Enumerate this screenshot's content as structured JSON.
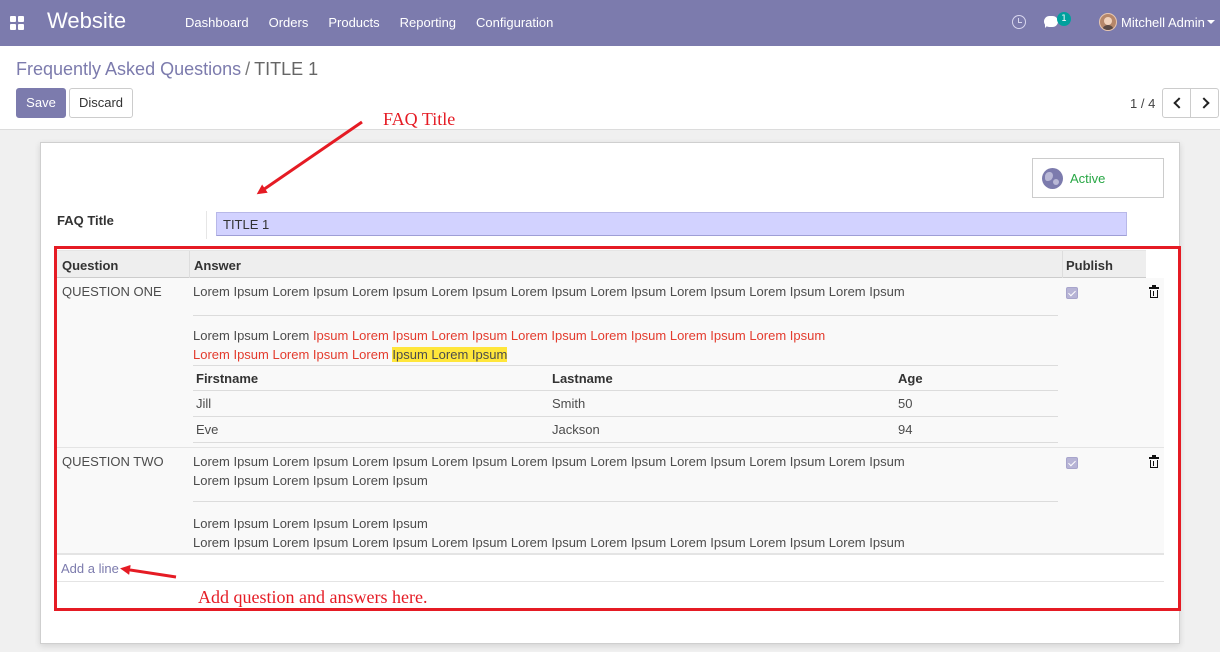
{
  "navbar": {
    "app_name": "Website",
    "menu": [
      "Dashboard",
      "Orders",
      "Products",
      "Reporting",
      "Configuration"
    ],
    "chat_badge": "1",
    "user_name": "Mitchell Admin"
  },
  "control_panel": {
    "breadcrumb_parent": "Frequently Asked Questions",
    "breadcrumb_separator": "/",
    "breadcrumb_current": "TITLE 1",
    "save_label": "Save",
    "discard_label": "Discard",
    "pager": "1 / 4"
  },
  "form": {
    "active_label": "Active",
    "faq_title_label": "FAQ Title",
    "faq_title_value": "TITLE 1"
  },
  "list": {
    "headers": {
      "question": "Question",
      "answer": "Answer",
      "publish": "Publish"
    },
    "rows": [
      {
        "question": "QUESTION ONE",
        "answer_line1": "Lorem Ipsum Lorem Ipsum Lorem Ipsum Lorem Ipsum Lorem Ipsum Lorem Ipsum Lorem Ipsum Lorem Ipsum Lorem Ipsum",
        "answer_line2_plain": "Lorem Ipsum Lorem ",
        "answer_line2_red": "Ipsum Lorem Ipsum Lorem Ipsum Lorem Ipsum Lorem Ipsum Lorem Ipsum Lorem Ipsum",
        "answer_line3_red": "Lorem Ipsum Lorem Ipsum Lorem ",
        "answer_line3_highlight": "Ipsum Lorem Ipsum",
        "published": true,
        "table": {
          "headers": [
            "Firstname",
            "Lastname",
            "Age"
          ],
          "rows": [
            [
              "Jill",
              "Smith",
              "50"
            ],
            [
              "Eve",
              "Jackson",
              "94"
            ]
          ]
        }
      },
      {
        "question": "QUESTION TWO",
        "answer_line1": "Lorem Ipsum Lorem Ipsum Lorem Ipsum Lorem Ipsum Lorem Ipsum Lorem Ipsum Lorem Ipsum Lorem Ipsum Lorem Ipsum",
        "answer_line2": "Lorem Ipsum Lorem Ipsum Lorem Ipsum",
        "answer_line3": "Lorem Ipsum Lorem Ipsum Lorem Ipsum",
        "answer_line4": "Lorem Ipsum Lorem Ipsum Lorem Ipsum Lorem Ipsum Lorem Ipsum Lorem Ipsum Lorem Ipsum Lorem Ipsum Lorem Ipsum",
        "published": true
      }
    ],
    "add_line": "Add a line"
  },
  "annotations": {
    "faq_title_note": "FAQ Title",
    "add_note": "Add question and answers here."
  },
  "colors": {
    "brand": "#7c7bad",
    "annotation": "#e51b24",
    "active": "#28a745"
  },
  "icons": [
    "apps-icon",
    "clock-icon",
    "chat-icon",
    "avatar",
    "caret-down-icon",
    "chevron-left-icon",
    "chevron-right-icon",
    "globe-icon",
    "checkbox-icon",
    "trash-icon"
  ]
}
